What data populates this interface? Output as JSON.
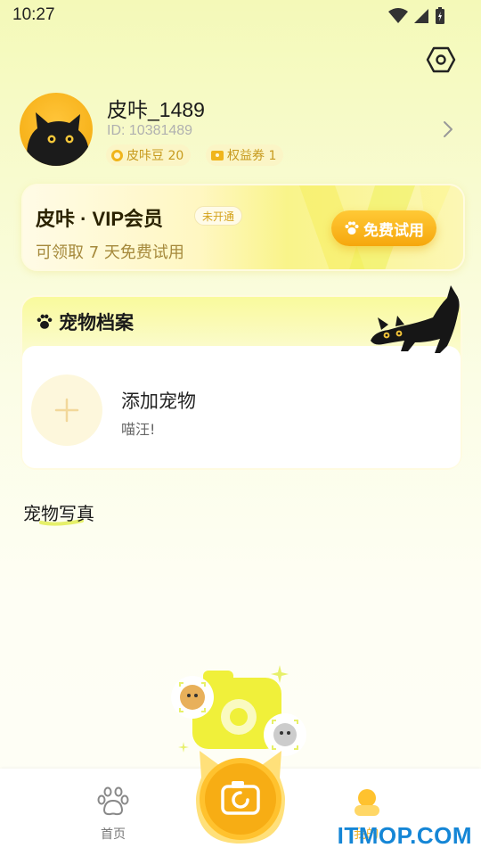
{
  "status_bar": {
    "time": "10:27"
  },
  "profile": {
    "username": "皮咔_1489",
    "user_id": "ID: 10381489",
    "beans": "皮咔豆 20",
    "coupons": "权益券 1"
  },
  "vip": {
    "title": "皮咔 · VIP会员",
    "badge": "未开通",
    "subtitle": "可领取 7 天免费试用",
    "button": "免费试用"
  },
  "pet_archive": {
    "title": "宠物档案",
    "add_title": "添加宠物",
    "add_subtitle": "喵汪!"
  },
  "photo_section": {
    "title": "宠物写真"
  },
  "bottom_nav": {
    "home": "首页",
    "mine": "我的"
  },
  "watermark": "ITMOP.COM",
  "colors": {
    "accent": "#f6a70d",
    "brand_yellow": "#ffc936",
    "background": "#f8fbd0"
  }
}
